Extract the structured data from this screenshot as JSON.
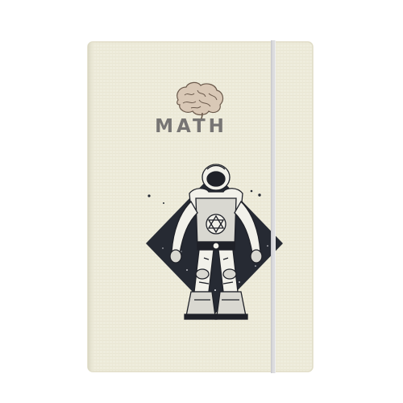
{
  "product": {
    "title": "MATH"
  },
  "icons": {
    "brain": "brain-icon",
    "astronaut": "astronaut-illustration",
    "diamond": "starfield-diamond"
  },
  "colors": {
    "cover": "#efeddd",
    "cover_edge": "#e2dfcb",
    "title": "#777574",
    "ink": "#22242b",
    "band": "#dcdcde",
    "background": "#ffffff"
  }
}
